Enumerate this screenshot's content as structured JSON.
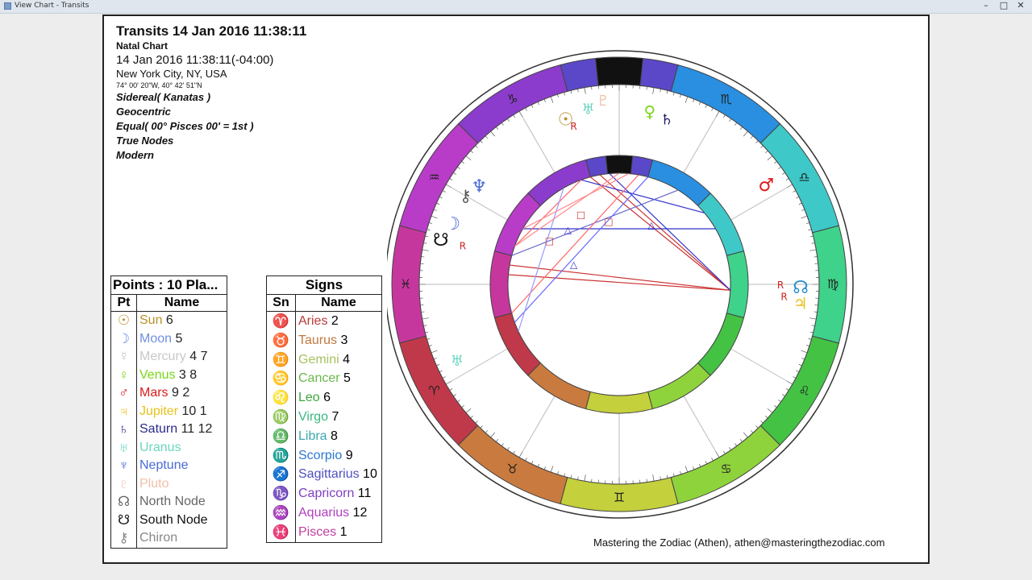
{
  "window": {
    "title": "View Chart - Transits"
  },
  "header": {
    "title": "Transits 14 Jan 2016 11:38:11",
    "chart_kind": "Natal Chart",
    "datetime": "14 Jan 2016 11:38:11(-04:00)",
    "location": "New York City, NY, USA",
    "coords": "74° 00' 20\"W, 40° 42' 51\"N",
    "zodiac": "Sidereal( Kanatas )",
    "center": "Geocentric",
    "houses": "Equal( 00° Pisces 00' = 1st )",
    "nodes": "True Nodes",
    "style": "Modern"
  },
  "points_table": {
    "title": "Points : 10 Pla...",
    "col_pt": "Pt",
    "col_name": "Name",
    "rows": [
      {
        "glyph": "☉",
        "name": "Sun",
        "num": "6",
        "color": "#b8902a"
      },
      {
        "glyph": "☽",
        "name": "Moon",
        "num": "5",
        "color": "#6f8fe0"
      },
      {
        "glyph": "☿",
        "name": "Mercury",
        "num": "4 7",
        "color": "#c8c8c8"
      },
      {
        "glyph": "♀",
        "name": "Venus",
        "num": "3 8",
        "color": "#7ad61a"
      },
      {
        "glyph": "♂",
        "name": "Mars",
        "num": "9  2",
        "color": "#dd1a1a"
      },
      {
        "glyph": "♃",
        "name": "Jupiter",
        "num": "10 1",
        "color": "#e6c21a"
      },
      {
        "glyph": "♄",
        "name": "Saturn",
        "num": "11 12",
        "color": "#2a2a8a"
      },
      {
        "glyph": "♅",
        "name": "Uranus",
        "num": "",
        "color": "#6ad6c0"
      },
      {
        "glyph": "♆",
        "name": "Neptune",
        "num": "",
        "color": "#4a6ad6"
      },
      {
        "glyph": "♇",
        "name": "Pluto",
        "num": "",
        "color": "#f0c0a8"
      },
      {
        "glyph": "☊",
        "name": "North Node",
        "num": "",
        "color": "#666666"
      },
      {
        "glyph": "☋",
        "name": "South Node",
        "num": "",
        "color": "#111111"
      },
      {
        "glyph": "⚷",
        "name": "Chiron",
        "num": "",
        "color": "#888888"
      }
    ]
  },
  "signs_table": {
    "title": "Signs",
    "col_sn": "Sn",
    "col_name": "Name",
    "rows": [
      {
        "glyph": "♈",
        "name": "Aries",
        "num": "2",
        "color": "#b83a3a"
      },
      {
        "glyph": "♉",
        "name": "Taurus",
        "num": "3",
        "color": "#c07840"
      },
      {
        "glyph": "♊",
        "name": "Gemini",
        "num": "4",
        "color": "#a8c060"
      },
      {
        "glyph": "♋",
        "name": "Cancer",
        "num": "5",
        "color": "#6ab84a"
      },
      {
        "glyph": "♌",
        "name": "Leo",
        "num": "6",
        "color": "#3aa83a"
      },
      {
        "glyph": "♍",
        "name": "Virgo",
        "num": "7",
        "color": "#3ab880"
      },
      {
        "glyph": "♎",
        "name": "Libra",
        "num": "8",
        "color": "#3aa8b0"
      },
      {
        "glyph": "♏",
        "name": "Scorpio",
        "num": "9",
        "color": "#2a78d0"
      },
      {
        "glyph": "♐",
        "name": "Sagittarius",
        "num": "10",
        "color": "#5050c0"
      },
      {
        "glyph": "♑",
        "name": "Capricorn",
        "num": "11",
        "color": "#8040c0"
      },
      {
        "glyph": "♒",
        "name": "Aquarius",
        "num": "12",
        "color": "#b040c0"
      },
      {
        "glyph": "♓",
        "name": "Pisces",
        "num": "1",
        "color": "#c040a0"
      }
    ]
  },
  "wheel": {
    "outer_signs": [
      {
        "glyph": "♓",
        "color": "#c6379e"
      },
      {
        "glyph": "♈",
        "color": "#c0394a"
      },
      {
        "glyph": "♉",
        "color": "#c97b3f"
      },
      {
        "glyph": "♊",
        "color": "#c4d03c"
      },
      {
        "glyph": "♋",
        "color": "#8fd33c"
      },
      {
        "glyph": "♌",
        "color": "#44c244"
      },
      {
        "glyph": "♍",
        "color": "#3fd28a"
      },
      {
        "glyph": "♎",
        "color": "#3fc8c8"
      },
      {
        "glyph": "♏",
        "color": "#2a8fe0"
      },
      {
        "glyph": "♐",
        "color": "#5a48c8"
      },
      {
        "glyph": "♑",
        "color": "#8c3ccc"
      },
      {
        "glyph": "♒",
        "color": "#b83cc8"
      }
    ],
    "planets": [
      {
        "glyph": "☉",
        "color": "#b8902a"
      },
      {
        "glyph": "♅",
        "color": "#6ad6c0"
      },
      {
        "glyph": "♇",
        "color": "#f0c0a8"
      },
      {
        "glyph": "♀",
        "color": "#7ad61a"
      },
      {
        "glyph": "♄",
        "color": "#1a1a6a"
      },
      {
        "glyph": "♂",
        "color": "#dd1a1a"
      },
      {
        "glyph": "☊",
        "color": "#2a8fd0"
      },
      {
        "glyph": "♃",
        "color": "#e6c21a"
      },
      {
        "glyph": "♆",
        "color": "#4a6ad6"
      },
      {
        "glyph": "⚷",
        "color": "#555555"
      },
      {
        "glyph": "☽",
        "color": "#4a6ad6"
      },
      {
        "glyph": "☋",
        "color": "#111111"
      },
      {
        "glyph": "♅",
        "color": "#6ad6c0"
      }
    ],
    "retro_label": "R",
    "retro_color": "#cc2222"
  },
  "footer": {
    "credit": "Mastering the Zodiac (Athen), athen@masteringthezodiac.com"
  }
}
